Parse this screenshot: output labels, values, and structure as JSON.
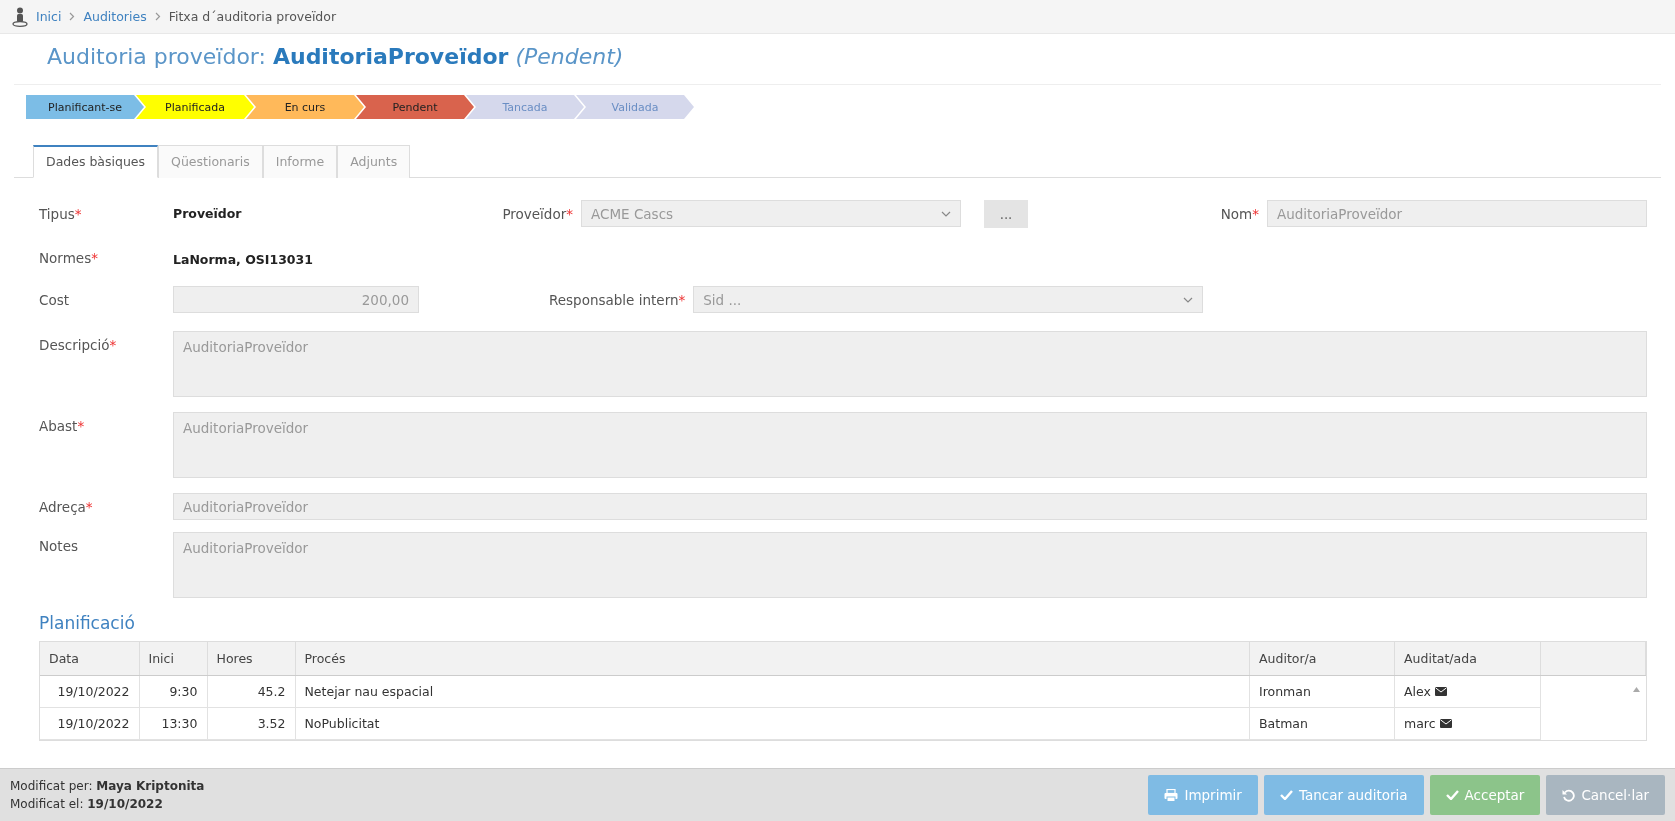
{
  "breadcrumb": [
    {
      "label": "Inici",
      "link": true
    },
    {
      "label": "Auditories",
      "link": true
    },
    {
      "label": "Fitxa d´auditoria proveïdor",
      "link": false
    }
  ],
  "title": {
    "prefix": "Auditoria proveïdor:",
    "name": "AuditoriaProveïdor",
    "status": "(Pendent)"
  },
  "steps": [
    {
      "label": "Planificant-se",
      "color": "#7cbde6",
      "reached": true
    },
    {
      "label": "Planificada",
      "color": "#ffff00",
      "reached": true
    },
    {
      "label": "En curs",
      "color": "#ffb95a",
      "reached": true
    },
    {
      "label": "Pendent",
      "color": "#d9634d",
      "reached": true
    },
    {
      "label": "Tancada",
      "color": "#d5d8ec",
      "reached": false
    },
    {
      "label": "Validada",
      "color": "#d5d8ec",
      "reached": false
    }
  ],
  "tabs": [
    {
      "label": "Dades bàsiques",
      "selected": true
    },
    {
      "label": "Qüestionaris",
      "selected": false
    },
    {
      "label": "Informe",
      "selected": false
    },
    {
      "label": "Adjunts",
      "selected": false
    }
  ],
  "form": {
    "tipus": {
      "label": "Tipus",
      "mark": "*",
      "value": "Proveïdor"
    },
    "proveidor": {
      "label": "Proveïdor",
      "mark": "*",
      "value": "ACME Cascs",
      "button": "..."
    },
    "nom": {
      "label": "Nom",
      "mark": "*",
      "value": "AuditoriaProveïdor"
    },
    "normes": {
      "label": "Normes",
      "mark": "*",
      "value": "LaNorma, OSI13031"
    },
    "cost": {
      "label": "Cost",
      "value": "200,00"
    },
    "responsable": {
      "label": "Responsable intern",
      "mark": "*",
      "value": "Sid ..."
    },
    "areas": [
      {
        "label": "Descripció",
        "mark": "*",
        "value": "AuditoriaProveïdor",
        "kind": "textarea"
      },
      {
        "label": "Abast",
        "mark": "*",
        "value": "AuditoriaProveïdor",
        "kind": "textarea"
      },
      {
        "label": "Adreça",
        "mark": "*",
        "value": "AuditoriaProveïdor",
        "kind": "input"
      },
      {
        "label": "Notes",
        "value": "AuditoriaProveïdor",
        "kind": "textarea"
      }
    ]
  },
  "planning": {
    "title": "Planificació",
    "columns": [
      "Data",
      "Inici",
      "Hores",
      "Procés",
      "Auditor/a",
      "Auditat/ada"
    ],
    "rows": [
      [
        "19/10/2022",
        "9:30",
        "45.2",
        "Netejar nau espacial",
        "Ironman",
        "Alex"
      ],
      [
        "19/10/2022",
        "13:30",
        "3.52",
        "NoPublicitat",
        "Batman",
        "marc"
      ]
    ]
  },
  "footer": {
    "modified_by_label": "Modificat per:",
    "modified_by": "Maya Kriptonita",
    "modified_on_label": "Modificat el:",
    "modified_on": "19/10/2022",
    "buttons": [
      {
        "label": "Imprimir",
        "kind": "print",
        "color": "#7fbbe4"
      },
      {
        "label": "Tancar auditoria",
        "kind": "check",
        "color": "#7fbbe4"
      },
      {
        "label": "Acceptar",
        "kind": "check",
        "color": "#8cc48a"
      },
      {
        "label": "Cancel·lar",
        "kind": "undo",
        "color": "#a9b6c0"
      }
    ]
  }
}
